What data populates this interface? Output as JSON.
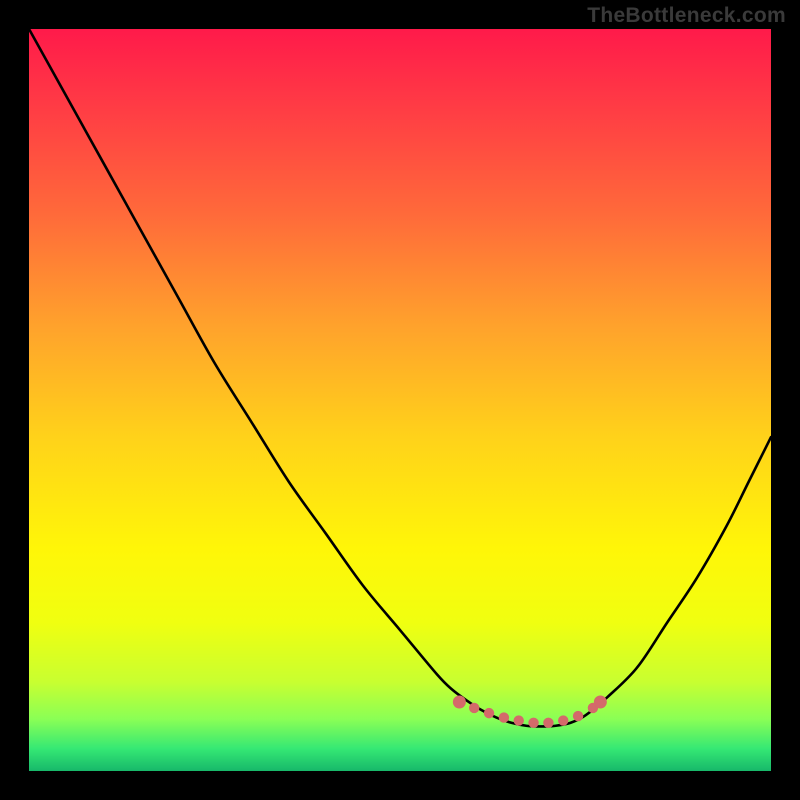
{
  "watermark": "TheBottleneck.com",
  "chart_data": {
    "type": "line",
    "title": "",
    "xlabel": "",
    "ylabel": "",
    "xlim": [
      0,
      100
    ],
    "ylim": [
      0,
      100
    ],
    "gradient_stops": [
      {
        "offset": 0.0,
        "color": "#ff1a4a"
      },
      {
        "offset": 0.1,
        "color": "#ff3a45"
      },
      {
        "offset": 0.25,
        "color": "#ff6a3a"
      },
      {
        "offset": 0.4,
        "color": "#ffa22c"
      },
      {
        "offset": 0.55,
        "color": "#ffd21a"
      },
      {
        "offset": 0.7,
        "color": "#fff608"
      },
      {
        "offset": 0.8,
        "color": "#f0ff10"
      },
      {
        "offset": 0.88,
        "color": "#c8ff30"
      },
      {
        "offset": 0.93,
        "color": "#8aff55"
      },
      {
        "offset": 0.97,
        "color": "#35e874"
      },
      {
        "offset": 1.0,
        "color": "#17b86a"
      }
    ],
    "series": [
      {
        "name": "bottleneck-curve",
        "color": "#000000",
        "x": [
          0,
          5,
          10,
          15,
          20,
          25,
          30,
          35,
          40,
          45,
          50,
          55,
          57,
          59,
          61,
          63,
          65,
          67,
          69,
          71,
          73,
          75,
          78,
          82,
          86,
          90,
          94,
          97,
          100
        ],
        "y": [
          100,
          91,
          82,
          73,
          64,
          55,
          47,
          39,
          32,
          25,
          19,
          13,
          11,
          9.5,
          8.2,
          7.2,
          6.5,
          6.1,
          6.0,
          6.1,
          6.5,
          7.5,
          10,
          14,
          20,
          26,
          33,
          39,
          45
        ]
      }
    ],
    "markers": {
      "name": "bottleneck-range",
      "color": "#d46a6a",
      "points": [
        {
          "x": 58,
          "y": 9.3
        },
        {
          "x": 60,
          "y": 8.5
        },
        {
          "x": 62,
          "y": 7.8
        },
        {
          "x": 64,
          "y": 7.2
        },
        {
          "x": 66,
          "y": 6.8
        },
        {
          "x": 68,
          "y": 6.5
        },
        {
          "x": 70,
          "y": 6.5
        },
        {
          "x": 72,
          "y": 6.8
        },
        {
          "x": 74,
          "y": 7.4
        },
        {
          "x": 76,
          "y": 8.5
        },
        {
          "x": 77,
          "y": 9.3
        }
      ]
    }
  }
}
